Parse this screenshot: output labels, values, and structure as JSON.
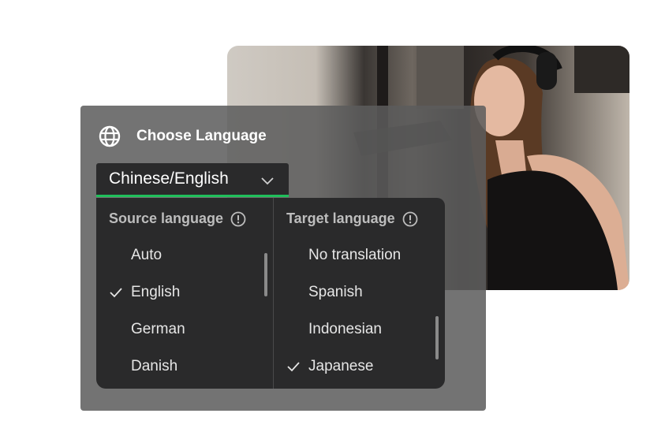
{
  "panel": {
    "title": "Choose Language",
    "selected_pair": "Chinese/English",
    "accent_color": "#1fbf5b"
  },
  "source": {
    "header": "Source language",
    "options": [
      "Auto",
      "English",
      "German",
      "Danish"
    ],
    "checked": "English"
  },
  "target": {
    "header": "Target language",
    "options": [
      "No translation",
      "Spanish",
      "Indonesian",
      "Japanese"
    ],
    "checked": "Japanese"
  },
  "icons": {
    "globe": "globe-icon",
    "chevron": "chevron-down-icon",
    "info": "info-icon",
    "check": "check-icon"
  }
}
